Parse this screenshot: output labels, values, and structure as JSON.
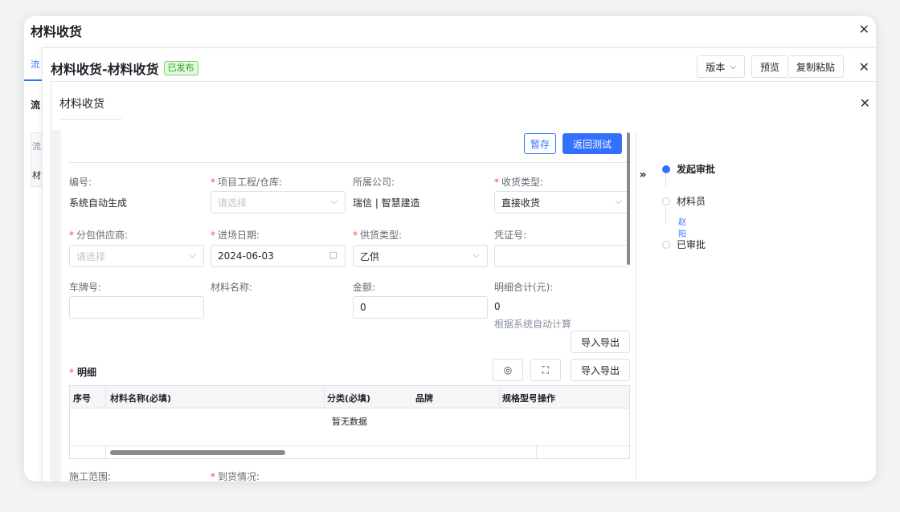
{
  "window1": {
    "title": "材料收货",
    "stub_tab": "流",
    "stub_label_1": "流",
    "stub_label_2": "流",
    "stub_label_3": "材"
  },
  "window2": {
    "title": "材料收货-材料收货",
    "status_badge": "已发布",
    "toolbar": {
      "version_label": "版本",
      "preview_label": "预览",
      "copy_paste_label": "复制粘贴"
    }
  },
  "panel": {
    "tab_label": "材料收货",
    "buttons": {
      "save_draft": "暂存",
      "return_test": "返回测试",
      "import_export_1": "导入导出",
      "import_export_2": "导入导出"
    },
    "fields": {
      "code": {
        "label": "编号:",
        "value": "系统自动生成"
      },
      "project": {
        "label": "项目工程/仓库:",
        "placeholder": "请选择"
      },
      "company": {
        "label": "所属公司:",
        "value": "瑞信 | 智慧建造"
      },
      "receive_type": {
        "label": "收货类型:",
        "value": "直接收货"
      },
      "supplier": {
        "label": "分包供应商:",
        "placeholder": "请选择"
      },
      "entry_date": {
        "label": "进场日期:",
        "value": "2024-06-03"
      },
      "supply_type": {
        "label": "供货类型:",
        "value": "乙供"
      },
      "voucher": {
        "label": "凭证号:",
        "value": ""
      },
      "plate": {
        "label": "车牌号:",
        "value": ""
      },
      "material_name": {
        "label": "材料名称:",
        "value": ""
      },
      "amount": {
        "label": "金额:",
        "value": "0"
      },
      "detail_total": {
        "label": "明细合计(元):",
        "value": "0",
        "note": "根据系统自动计算"
      },
      "scope": {
        "label": "施工范围:"
      },
      "arrival": {
        "label": "到货情况:"
      }
    },
    "detail": {
      "title": "明细",
      "columns": [
        "序号",
        "材料名称(必填)",
        "分类(必填)",
        "品牌",
        "规格型号",
        "操作"
      ],
      "empty_text": "暂无数据"
    }
  },
  "flow": {
    "nodes": [
      {
        "label": "发起审批",
        "state": "active"
      },
      {
        "label": "材料员",
        "state": "pending",
        "sub": "赵阳"
      },
      {
        "label": "已审批",
        "state": "pending"
      }
    ]
  },
  "colors": {
    "primary": "#3370ff",
    "required": "#f54a45",
    "badge_green": "#2ea121"
  }
}
